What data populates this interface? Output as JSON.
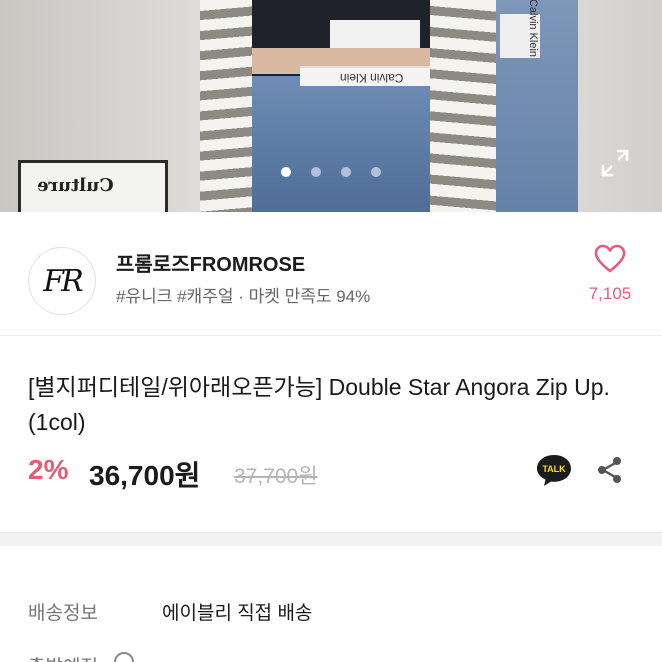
{
  "hero": {
    "poster_text": "Culture",
    "waistband_text": "Calvin Klein",
    "jeans_band_text": "Calvin Klein",
    "carousel": {
      "total": 4,
      "active_index": 0
    }
  },
  "seller": {
    "avatar_text": "FR",
    "name": "프롬로즈FROMROSE",
    "tags": "#유니크 #캐주얼 · 마켓 만족도 94%",
    "like_count": "7,105"
  },
  "product": {
    "title": "[별지퍼디테일/위아래오픈가능] Double Star Angora Zip Up. (1col)",
    "discount": "2%",
    "price": "36,700원",
    "original_price": "37,700원",
    "talk_label": "TALK"
  },
  "shipping": {
    "label": "배송정보",
    "value": "에이블리 직접 배송",
    "next_label": "출발예정"
  },
  "colors": {
    "accent_pink": "#e35d7a",
    "kakao_yellow": "#f9e000"
  }
}
